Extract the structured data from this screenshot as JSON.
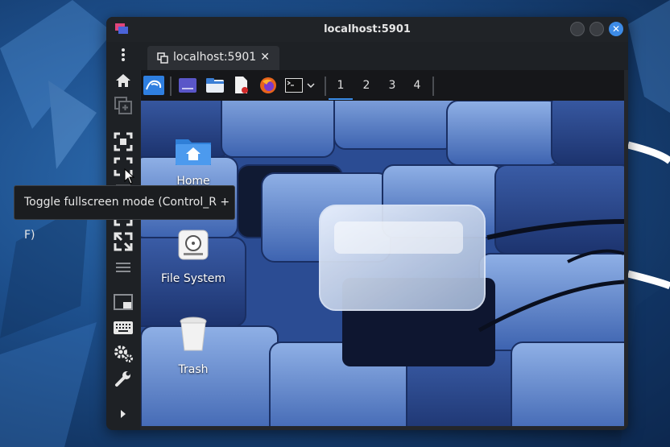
{
  "window": {
    "title": "localhost:5901",
    "app_icon": "remmina-app-icon",
    "controls": [
      "minimize",
      "maximize",
      "close"
    ]
  },
  "tab": {
    "label": "localhost:5901",
    "close_glyph": "✕"
  },
  "sidebar": {
    "items": [
      {
        "name": "menu-dots-icon"
      },
      {
        "name": "home-icon"
      },
      {
        "name": "duplicate-icon"
      },
      {
        "name": "fit-window-icon"
      },
      {
        "name": "toggle-fullscreen-icon"
      },
      {
        "name": "scroll-icon"
      },
      {
        "name": "dynamic-resolution-icon"
      },
      {
        "name": "scaled-mode-icon"
      },
      {
        "name": "hamburger-menu-icon"
      },
      {
        "name": "multi-monitor-icon"
      },
      {
        "name": "keyboard-icon"
      },
      {
        "name": "preferences-gears-icon"
      },
      {
        "name": "tools-wrench-icon"
      },
      {
        "name": "collapse-arrow-icon"
      }
    ]
  },
  "tooltip": {
    "text": "Toggle fullscreen mode (Control_R + F)"
  },
  "remote_panel": {
    "launchers": [
      {
        "name": "kali-menu-icon"
      },
      {
        "name": "show-desktop-icon"
      },
      {
        "name": "file-manager-icon"
      },
      {
        "name": "text-editor-icon"
      },
      {
        "name": "firefox-icon"
      },
      {
        "name": "terminal-icon"
      },
      {
        "name": "launcher-dropdown-icon"
      }
    ],
    "workspaces": [
      "1",
      "2",
      "3",
      "4"
    ],
    "active_workspace": "1",
    "accent": "#3b8eea"
  },
  "desktop": {
    "icons": [
      {
        "label": "Home",
        "icon": "home-folder-icon"
      },
      {
        "label": "File System",
        "icon": "drive-icon"
      },
      {
        "label": "Trash",
        "icon": "trash-icon"
      }
    ]
  }
}
